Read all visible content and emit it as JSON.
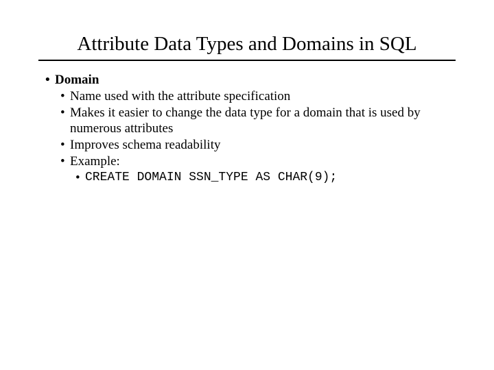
{
  "title": "Attribute Data Types and Domains in SQL",
  "bullet": "•",
  "level1": {
    "item": "Domain"
  },
  "sub": {
    "a": "Name used with the attribute specification",
    "b": "Makes it easier to change the data type for a domain that is used by numerous attributes",
    "c": "Improves schema readability",
    "d": "Example:"
  },
  "example": {
    "code": "CREATE DOMAIN SSN_TYPE AS CHAR(9);"
  }
}
